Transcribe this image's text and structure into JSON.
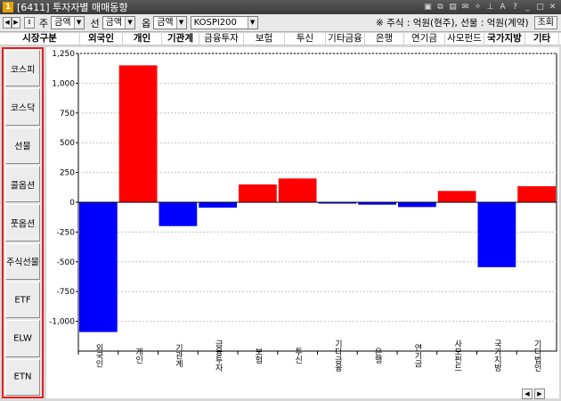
{
  "window": {
    "icon_label": "1",
    "title": "[6411] 투자자별 매매동향",
    "buttons": [
      {
        "name": "window-lock-icon",
        "glyph": "▣"
      },
      {
        "name": "window-copy-icon",
        "glyph": "⧉"
      },
      {
        "name": "window-save-icon",
        "glyph": "▤"
      },
      {
        "name": "window-mail-icon",
        "glyph": "✉"
      },
      {
        "name": "window-alert-icon",
        "glyph": "✧"
      },
      {
        "name": "window-pin-icon",
        "glyph": "⊥"
      },
      {
        "name": "window-font-icon",
        "glyph": "A"
      },
      {
        "name": "window-help-icon",
        "glyph": "?"
      },
      {
        "name": "window-minimize-icon",
        "glyph": "_"
      },
      {
        "name": "window-maximize-icon",
        "glyph": "□"
      },
      {
        "name": "window-close-icon",
        "glyph": "✕"
      }
    ]
  },
  "toolbar": {
    "nav_left_glyph": "◀",
    "nav_right_glyph": "▶",
    "sort_glyph": "⇕",
    "main_label": "주",
    "main_select": "금액",
    "line_label": "선",
    "line_select": "금액",
    "opt_label": "옵",
    "opt_select": "금액",
    "index_select": "KOSPI200",
    "dropdown_glyph": "▼",
    "unit_text": "※ 주식 : 억원(현주), 선물 : 억원(계약)",
    "query_button": "조회"
  },
  "header": {
    "market_label": "시장구분",
    "columns": [
      "외국인",
      "개인",
      "기관계",
      "금융투자",
      "보험",
      "투신",
      "기타금융",
      "은행",
      "연기금",
      "사모펀드",
      "국가지방",
      "기타"
    ],
    "bold": [
      true,
      true,
      true,
      false,
      false,
      false,
      false,
      false,
      false,
      false,
      true,
      true
    ]
  },
  "sidebar": {
    "items": [
      "코스피",
      "코스닥",
      "선물",
      "콜옵션",
      "풋옵션",
      "주식선물",
      "ETF",
      "ELW",
      "ETN"
    ]
  },
  "chart_data": {
    "type": "bar",
    "categories": [
      "외국인",
      "개인",
      "기관계",
      "금융투자",
      "보험",
      "투신",
      "기타금융",
      "은행",
      "연기금",
      "사모펀드",
      "국가지방",
      "기타법인"
    ],
    "values": [
      -1090,
      1150,
      -200,
      -45,
      150,
      200,
      -5,
      -20,
      -40,
      95,
      -545,
      135
    ],
    "ylim": [
      -1250,
      1250
    ],
    "yticks": [
      1250,
      1000,
      750,
      500,
      250,
      0,
      -250,
      -500,
      -750,
      -1000
    ],
    "ytick_labels": [
      "1,250",
      "1,000",
      "750",
      "500",
      "250",
      "0",
      "-250",
      "-500",
      "-750",
      "-1,000"
    ],
    "grid": true,
    "positive_color": "#ff0000",
    "negative_color": "#0000ff",
    "xlabel": "",
    "ylabel": "",
    "title": ""
  },
  "scroll": {
    "left_glyph": "◀",
    "right_glyph": "▶"
  }
}
